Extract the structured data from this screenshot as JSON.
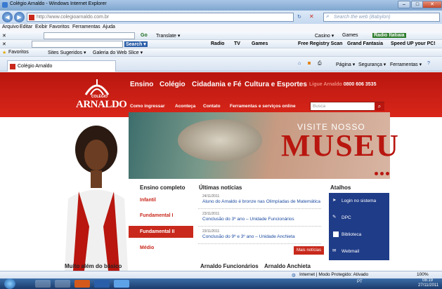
{
  "window": {
    "title": "Colégio Arnaldo - Windows Internet Explorer"
  },
  "address": {
    "url": "http://www.colegioarnaldo.com.br",
    "search_placeholder": "Search the web (Babylon)"
  },
  "menu": [
    "Arquivo",
    "Editar",
    "Exibir",
    "Favoritos",
    "Ferramentas",
    "Ajuda"
  ],
  "toolbar1": {
    "go": "Go",
    "translate": "Translate ▾",
    "casino": "Casino ▾",
    "games": "Games",
    "radio": "Radio Itatiaia"
  },
  "toolbar2": {
    "search": "Search ▾",
    "radio": "Radio",
    "tv": "TV",
    "games": "Games",
    "registry": "Free Registry Scan",
    "grand": "Grand Fantasia",
    "speed": "Speed UP your PC!"
  },
  "favbar": {
    "favoritos": "Favoritos",
    "sugeridos": "Sites Sugeridos ▾",
    "galeria": "Galeria do Web Slice ▾"
  },
  "tab": {
    "label": "Colégio Arnaldo"
  },
  "cmdbar": {
    "pagina": "Página ▾",
    "seguranca": "Segurança ▾",
    "ferramentas": "Ferramentas ▾"
  },
  "site": {
    "logo_top": "COLÉGIO",
    "logo_name": "ARNALDO",
    "nav": [
      "Ensino",
      "Colégio",
      "Cidadania e Fé",
      "Cultura e Esportes"
    ],
    "subnav": [
      "Como ingressar",
      "Aconteça",
      "Contato",
      "Ferramentas e serviços online"
    ],
    "phone_label": "Ligue Arnaldo",
    "phone": "0800 606 3535",
    "search_placeholder": "Busca",
    "banner_top": "VISITE NOSSO",
    "banner_main": "MUSEU",
    "ensino_title": "Ensino completo",
    "ensino": [
      "Infantil",
      "Fundamental I",
      "Fundamental II",
      "Médio"
    ],
    "news_title": "Últimas notícias",
    "news": [
      {
        "date": "24/11/2011",
        "text": "Aluno do Arnaldo é bronze nas Olimpíadas de Matemática"
      },
      {
        "date": "23/11/2011",
        "text": "Conclusão do 3º ano – Unidade Funcionários"
      },
      {
        "date": "23/11/2011",
        "text": "Conclusão do 9º e 3º ano – Unidade Anchieta"
      }
    ],
    "mais": "Mais notícias",
    "atalhos_title": "Atalhos",
    "atalhos": [
      "Login no sistema",
      "DPC",
      "Biblioteca",
      "Webmail"
    ],
    "bottom": [
      "Muito além do básico",
      "Arnaldo Funcionários",
      "Arnaldo Anchieta"
    ]
  },
  "status": {
    "zone": "Internet | Modo Protegido: Ativado",
    "zoom": "100%"
  },
  "clock": {
    "time": "08:19",
    "date": "27/11/2011",
    "lang": "PT"
  }
}
